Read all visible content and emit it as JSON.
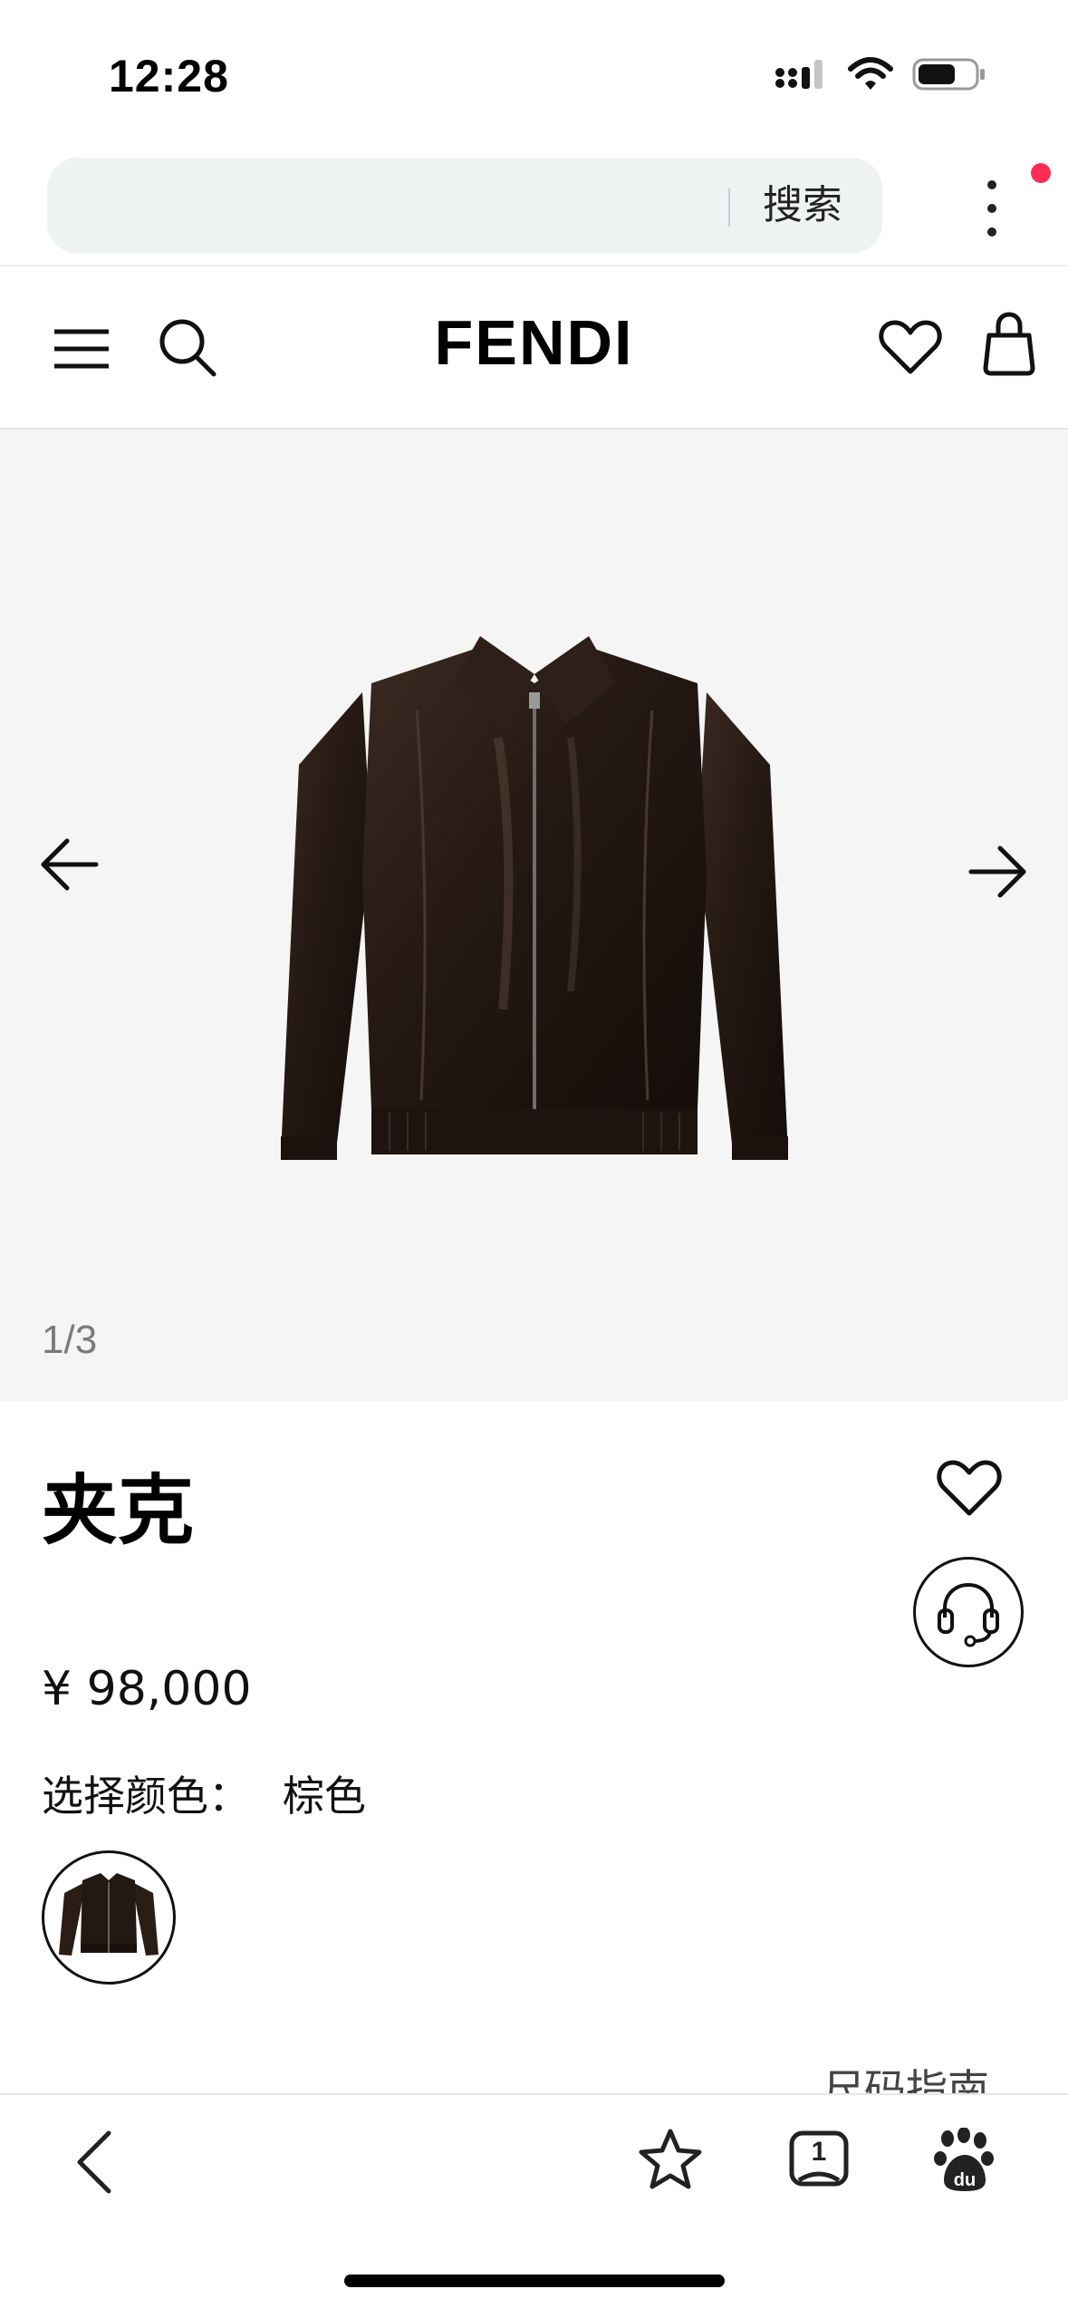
{
  "status_bar": {
    "time": "12:28",
    "battery_level": 0.6
  },
  "browser": {
    "search_placeholder": "",
    "search_button": "搜索",
    "notification_dot_color": "#ff2d55"
  },
  "site": {
    "logo": "FENDI",
    "icons": [
      "menu-icon",
      "search-icon",
      "heart-icon",
      "shopping-bag-icon"
    ]
  },
  "gallery": {
    "counter": "1/3",
    "current": 1,
    "total": 3,
    "image": "brown-leather-jacket"
  },
  "product": {
    "title": "夹克",
    "price": "¥ 98,000",
    "color_label": "选择颜色：",
    "color_value": "棕色",
    "size_guide": "尺码指南"
  },
  "toolbar": {
    "icons": [
      "back-icon",
      "star-icon",
      "tabs-icon",
      "baidu-icon"
    ],
    "tab_count": "1"
  }
}
